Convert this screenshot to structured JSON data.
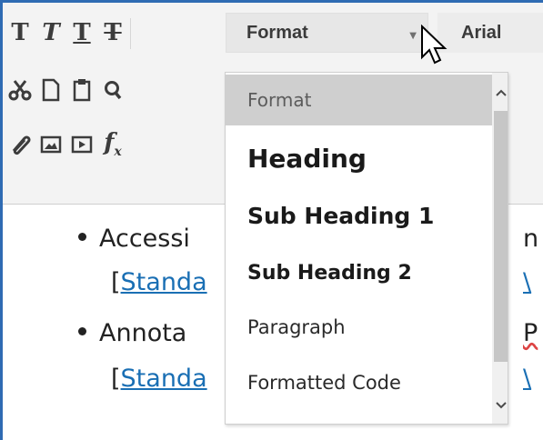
{
  "toolbar": {
    "row1": {
      "bold_glyph": "T",
      "italic_glyph": "T",
      "underline_glyph": "T",
      "strike_glyph": "T",
      "format_select_label": "Format",
      "font_select_label": "Arial"
    },
    "row2_icons": [
      "scissors-icon",
      "new-document-icon",
      "clipboard-icon",
      "search-icon"
    ],
    "row3_icons": [
      "paperclip-icon",
      "image-icon",
      "video-icon",
      "formula-icon"
    ],
    "formula_label": "f",
    "formula_sub": "x"
  },
  "dropdown": {
    "items": [
      {
        "label": "Format"
      },
      {
        "label": "Heading"
      },
      {
        "label": "Sub Heading 1"
      },
      {
        "label": "Sub Heading 2"
      },
      {
        "label": "Paragraph"
      },
      {
        "label": "Formatted Code"
      }
    ],
    "scroll_up": "^",
    "scroll_down": "v"
  },
  "content": {
    "bullets": [
      {
        "text": "Accessi",
        "link_prefix": "[",
        "link": "Standa",
        "trailing": "n",
        "trailing2": "\\"
      },
      {
        "text": "Annota",
        "link_prefix": "[",
        "link": "Standa",
        "trailing": "P",
        "trailing2": "\\"
      }
    ]
  },
  "colors": {
    "frame_border": "#2f6bb3",
    "link": "#1a6fb4",
    "dropdown_header_bg": "#cfcfcf"
  }
}
